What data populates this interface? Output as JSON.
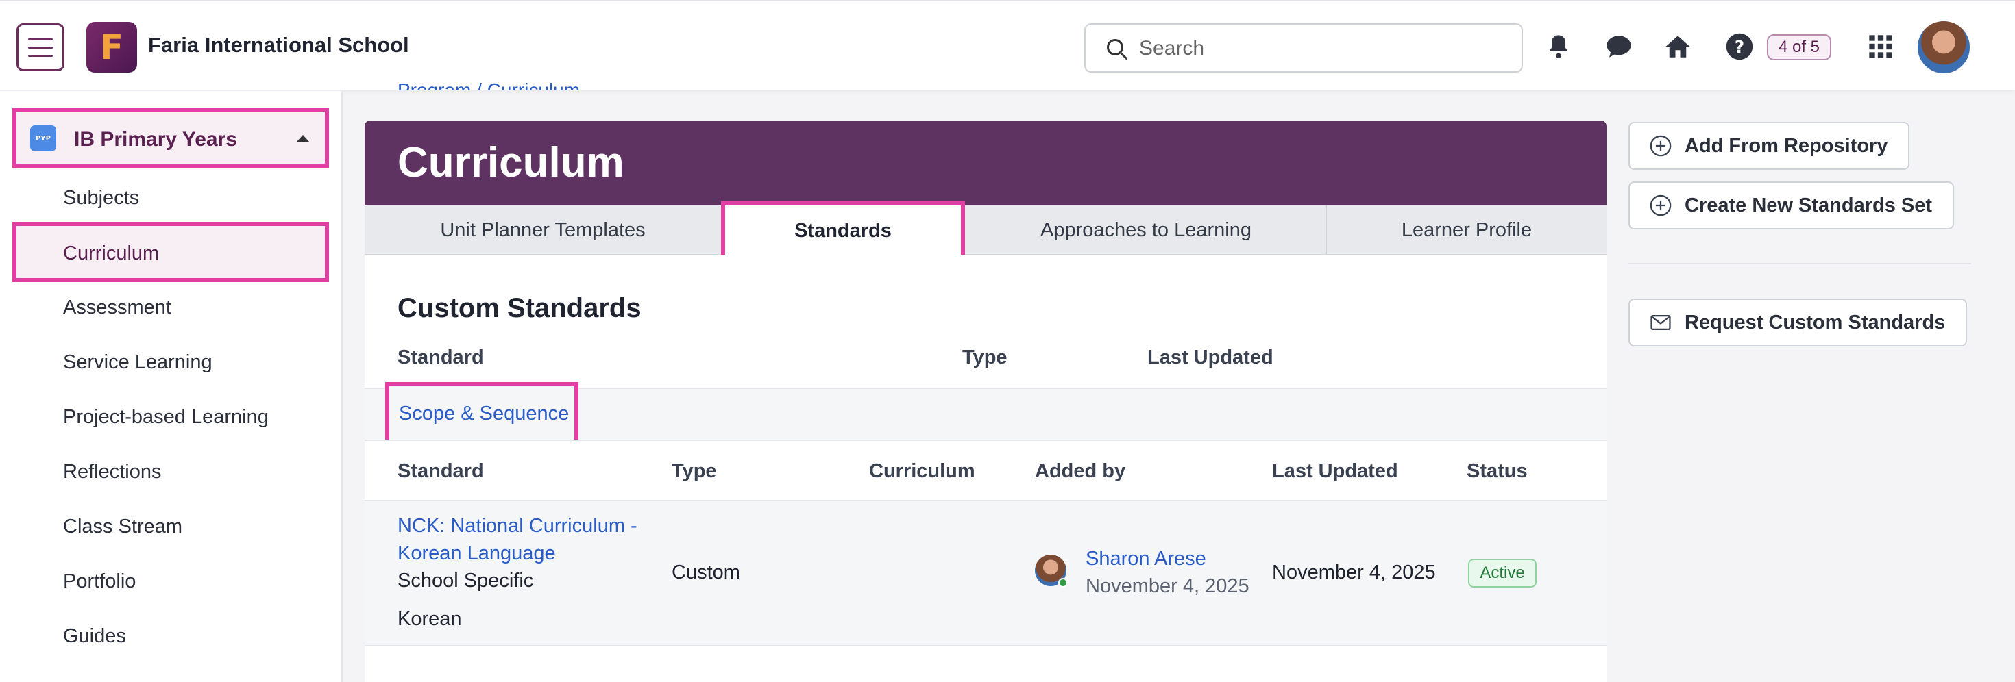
{
  "header": {
    "school_name": "Faria International School",
    "logo_letter": "F",
    "search_placeholder": "Search",
    "help_badge": "4 of 5"
  },
  "sidebar": {
    "program_label": "IB Primary Years",
    "program_icon_text": "PYP",
    "items": [
      {
        "label": "Subjects"
      },
      {
        "label": "Curriculum"
      },
      {
        "label": "Assessment"
      },
      {
        "label": "Service Learning"
      },
      {
        "label": "Project-based Learning"
      },
      {
        "label": "Reflections"
      },
      {
        "label": "Class Stream"
      },
      {
        "label": "Portfolio"
      },
      {
        "label": "Guides"
      }
    ]
  },
  "breadcrumb": {
    "text": "Program / Curriculum"
  },
  "page": {
    "title": "Curriculum",
    "tabs": [
      {
        "label": "Unit Planner Templates"
      },
      {
        "label": "Standards"
      },
      {
        "label": "Approaches to Learning"
      },
      {
        "label": "Learner Profile"
      }
    ],
    "section_title": "Custom Standards",
    "outer_columns": {
      "standard": "Standard",
      "type": "Type",
      "last_updated": "Last Updated"
    },
    "group_link": "Scope & Sequence",
    "inner_columns": {
      "standard": "Standard",
      "type": "Type",
      "curriculum": "Curriculum",
      "added_by": "Added by",
      "last_updated": "Last Updated",
      "status": "Status"
    },
    "rows": [
      {
        "standard_line1": "NCK: National Curriculum -",
        "standard_line2": "Korean Language",
        "school_specific": "School Specific",
        "language": "Korean",
        "type": "Custom",
        "added_by_name": "Sharon Arese",
        "added_by_date": "November 4, 2025",
        "last_updated": "November 4, 2025",
        "status": "Active"
      }
    ]
  },
  "right_actions": {
    "add_from_repository": "Add From Repository",
    "create_new_set": "Create New Standards Set",
    "request_custom": "Request Custom Standards"
  },
  "colors": {
    "brand_purple": "#5e3361",
    "highlight_pink": "#e23fa5",
    "link_blue": "#2a5cc8",
    "status_green": "#237a3a"
  }
}
